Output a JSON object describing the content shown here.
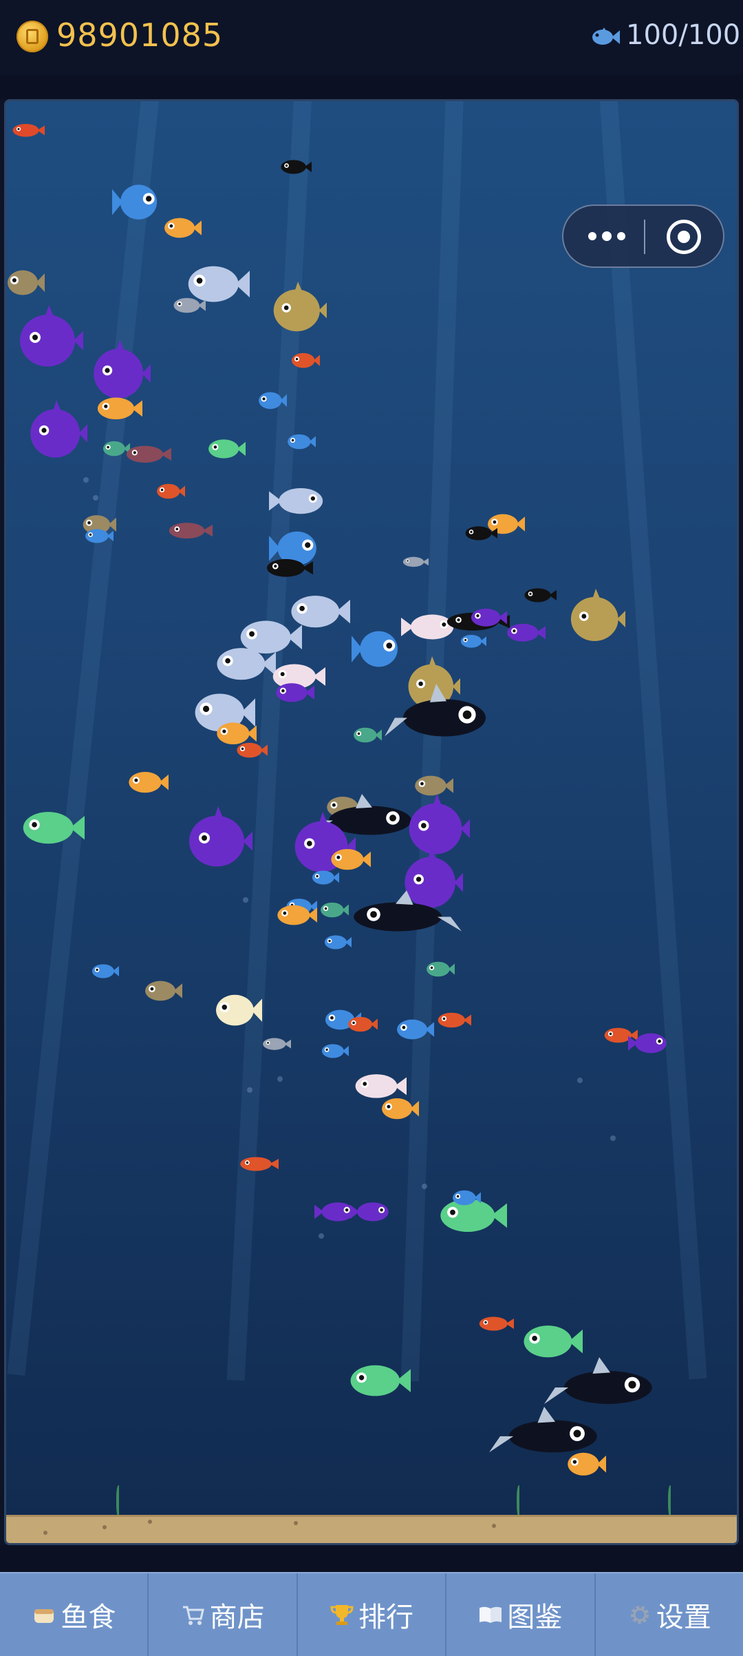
{
  "header": {
    "coins": "98901085",
    "coin_icon": "coin-icon",
    "fish_icon": "fish-icon",
    "fish_count": "100/100"
  },
  "capsule": {
    "more_icon": "more-icon",
    "close_icon": "target-icon"
  },
  "nav": [
    {
      "label": "鱼食",
      "icon": "bread-icon"
    },
    {
      "label": "商店",
      "icon": "cart-icon"
    },
    {
      "label": "排行",
      "icon": "trophy-icon"
    },
    {
      "label": "图鉴",
      "icon": "book-icon"
    },
    {
      "label": "设置",
      "icon": "gear-icon"
    }
  ],
  "colors": {
    "water_top": "#1f4d80",
    "water_bottom": "#112a4f",
    "sand": "#c4a876",
    "coin_text": "#f2c14e",
    "nav_bg": "#6f93c9"
  }
}
